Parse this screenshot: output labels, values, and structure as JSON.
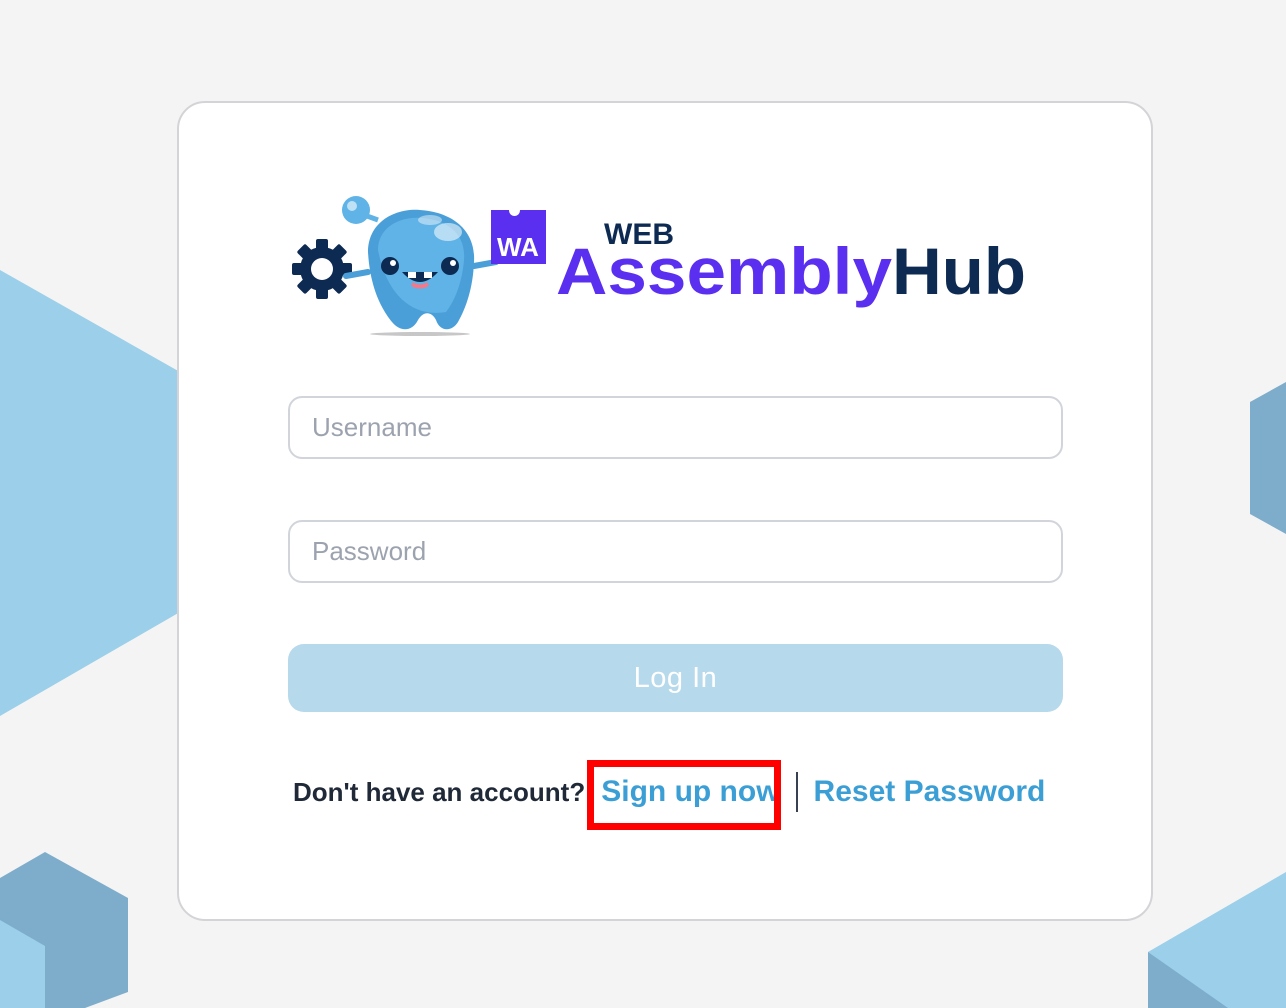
{
  "brand": {
    "badge": "WA",
    "word_web": "WEB",
    "word_assembly": "Assembly",
    "word_hub": "Hub",
    "logo_name": "WebAssembly Hub"
  },
  "form": {
    "username_placeholder": "Username",
    "username_value": "",
    "password_placeholder": "Password",
    "password_value": "",
    "login_label": "Log In",
    "login_disabled": true
  },
  "links": {
    "no_account_text": "Don't have an account?",
    "signup_label": "Sign up now",
    "signup_highlighted": true,
    "reset_label": "Reset Password"
  },
  "colors": {
    "background": "#f4f4f4",
    "card": "#ffffff",
    "link": "#3b9fd6",
    "button_disabled": "#b6d9ec",
    "brand_purple": "#5b2ff0",
    "brand_navy": "#0d2a52",
    "mascot_blue": "#5fb3e6",
    "highlight_box": "#ff0000",
    "bg_shape_light": "#9bcfea",
    "bg_shape_dark": "#7eadcc"
  },
  "icons": {
    "mascot": "mascot-icon",
    "gear": "gear-icon",
    "badge": "wa-badge-icon"
  }
}
